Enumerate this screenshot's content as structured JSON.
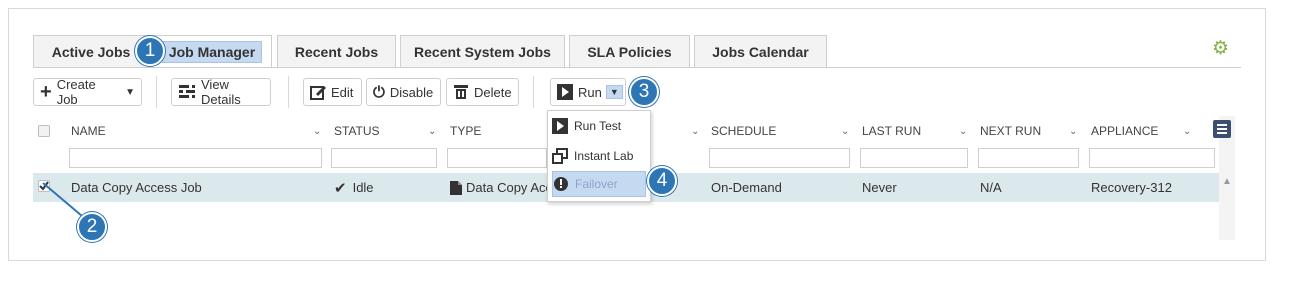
{
  "tabs": [
    {
      "label": "Active Jobs"
    },
    {
      "label": "Job Manager"
    },
    {
      "label": "Recent Jobs"
    },
    {
      "label": "Recent System Jobs"
    },
    {
      "label": "SLA Policies"
    },
    {
      "label": "Jobs Calendar"
    }
  ],
  "toolbar": {
    "create_job": "Create Job",
    "view_details": "View Details",
    "edit": "Edit",
    "disable": "Disable",
    "delete": "Delete",
    "run": "Run"
  },
  "run_menu": [
    {
      "label": "Run Test",
      "icon": "play-icon"
    },
    {
      "label": "Instant Lab",
      "icon": "windows-icon"
    },
    {
      "label": "Failover",
      "icon": "alert-icon"
    }
  ],
  "columns": [
    "NAME",
    "STATUS",
    "TYPE",
    "SCHEDULE",
    "LAST RUN",
    "NEXT RUN",
    "APPLIANCE"
  ],
  "row": {
    "name": "Data Copy Access Job",
    "status": "Idle",
    "type": "Data Copy Access",
    "schedule": "On-Demand",
    "last_run": "Never",
    "next_run": "N/A",
    "appliance": "Recovery-312"
  },
  "callouts": [
    "1",
    "2",
    "3",
    "4"
  ],
  "colors": {
    "accent": "#2e75b6",
    "highlight": "#c5d9f1",
    "row": "#dce9ec",
    "gear": "#7cb342"
  }
}
